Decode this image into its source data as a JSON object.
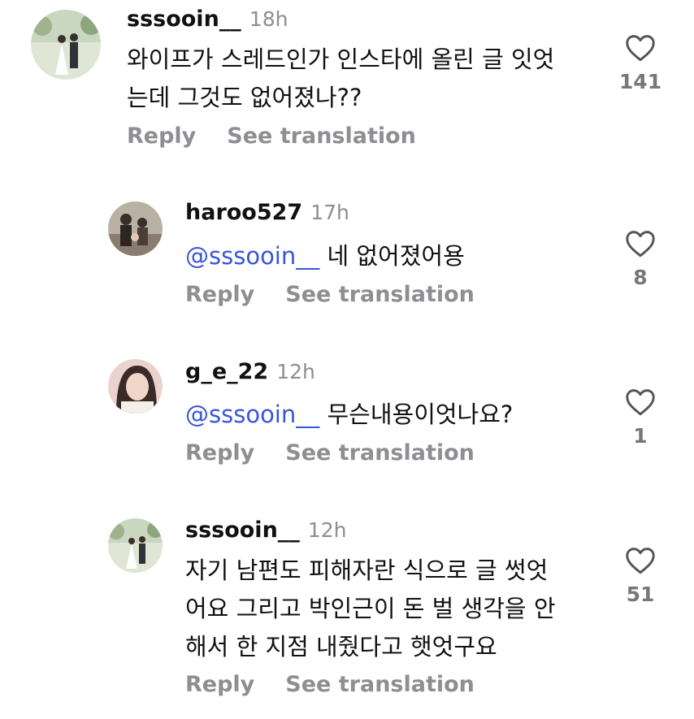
{
  "comments": [
    {
      "username": "sssooin__",
      "time": "18h",
      "text_lines": [
        "와이프가 스레드인가 인스타에 올린 글 잇엇",
        "는데 그것도 없어졌나??"
      ],
      "mention": "",
      "reply_label": "Reply",
      "translate_label": "See translation",
      "likes": "141",
      "avatar_colors": [
        "#cfd8c4",
        "#7d8f6b"
      ]
    },
    {
      "username": "haroo527",
      "time": "17h",
      "mention": "@sssooin__",
      "text": "네 없어졌어용",
      "reply_label": "Reply",
      "translate_label": "See translation",
      "likes": "8",
      "avatar_colors": [
        "#b9b1a4",
        "#4a3d36"
      ]
    },
    {
      "username": "g_e_22",
      "time": "12h",
      "mention": "@sssooin__",
      "text": "무슨내용이엇나요?",
      "reply_label": "Reply",
      "translate_label": "See translation",
      "likes": "1",
      "avatar_colors": [
        "#e9d3cc",
        "#3a2a28"
      ]
    },
    {
      "username": "sssooin__",
      "time": "12h",
      "text_lines": [
        "자기 남편도 피해자란 식으로 글 썻엇",
        "어요 그리고 박인근이 돈 벌 생각을 안",
        "해서 한 지점 내줬다고 햇엇구요"
      ],
      "mention": "",
      "reply_label": "Reply",
      "translate_label": "See translation",
      "likes": "51",
      "avatar_colors": [
        "#cfd8c4",
        "#7d8f6b"
      ]
    }
  ],
  "colors": {
    "mention": "#3b56d8",
    "secondary_text": "#8e8e93",
    "like_icon": "#555555"
  },
  "icons": {
    "like": "heart-outline-icon",
    "mention": "threads-at-icon"
  }
}
